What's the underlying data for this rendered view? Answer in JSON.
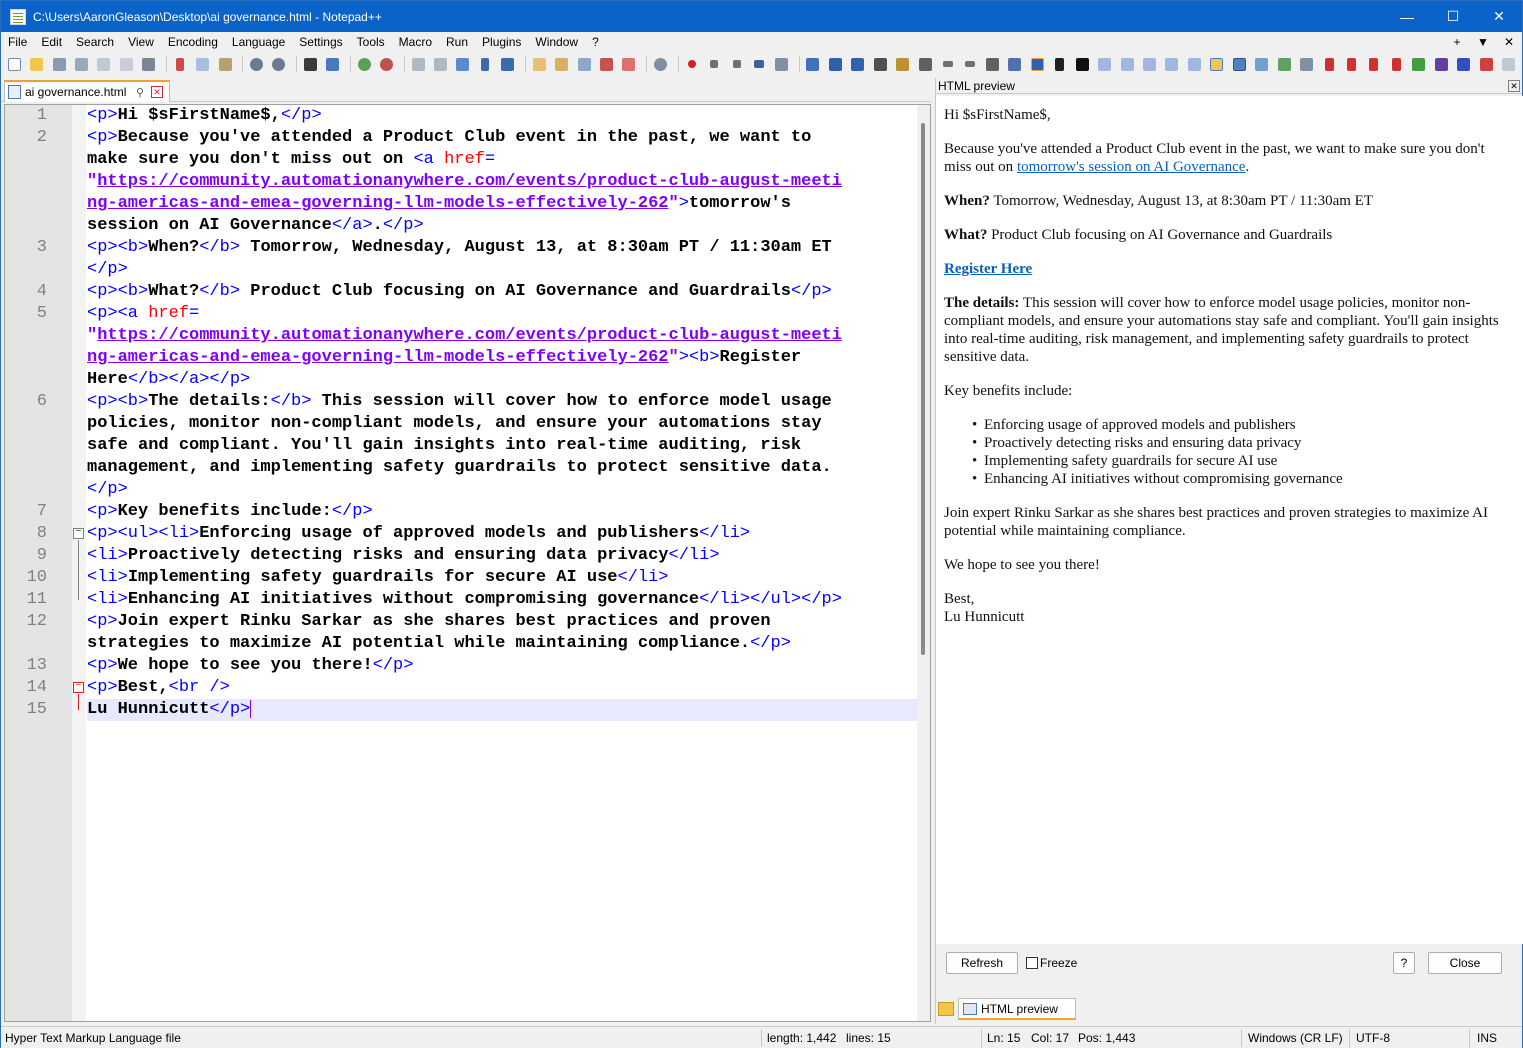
{
  "window": {
    "title": "C:\\Users\\AaronGleason\\Desktop\\ai governance.html - Notepad++",
    "minimize": "—",
    "maximize": "☐",
    "close": "✕"
  },
  "menu": [
    "File",
    "Edit",
    "Search",
    "View",
    "Encoding",
    "Language",
    "Settings",
    "Tools",
    "Macro",
    "Run",
    "Plugins",
    "Window",
    "?"
  ],
  "menu_right": [
    "+",
    "▼",
    "✕"
  ],
  "tab": {
    "label": "ai governance.html",
    "pin": "⚲",
    "close": "✕"
  },
  "editor": {
    "line_numbers": [
      "1",
      "2",
      "3",
      "4",
      "5",
      "6",
      "7",
      "8",
      "9",
      "10",
      "11",
      "12",
      "13",
      "14",
      "15"
    ],
    "l1": {
      "tag_open": "<p>",
      "text": "Hi $sFirstName$,",
      "tag_close": "</p>"
    },
    "l2": {
      "a": "<p>",
      "b": "Because you've attended a Product Club event in the past, we want to",
      "c": "make sure you don't miss out on ",
      "d": "<a ",
      "e": "href",
      "f": "=",
      "g": "\"",
      "h": "https://community.automationanywhere.com/events/product-club-august-meeti",
      "i": "ng-americas-and-emea-governing-llm-models-effectively-262",
      "j": "\"",
      "k": ">",
      "l": "tomorrow's",
      "m": "session on AI Governance",
      "n": "</a>",
      "o": ".",
      "p": "</p>"
    },
    "l3": {
      "a": "<p><b>",
      "b": "When?",
      "c": "</b>",
      "d": " Tomorrow, Wednesday, August 13, at 8:30am PT / 11:30am ET",
      "e": "</p>"
    },
    "l4": {
      "a": "<p><b>",
      "b": "What?",
      "c": "</b>",
      "d": " Product Club focusing on AI Governance and Guardrails",
      "e": "</p>"
    },
    "l5": {
      "a": "<p><a ",
      "b": "href",
      "c": "=",
      "d": "\"",
      "e": "https://community.automationanywhere.com/events/product-club-august-meeti",
      "f": "ng-americas-and-emea-governing-llm-models-effectively-262",
      "g": "\"",
      "h": "><b>",
      "i": "Register",
      "j": "Here",
      "k": "</b></a></p>"
    },
    "l6": {
      "a": "<p><b>",
      "b": "The details:",
      "c": "</b>",
      "d": " This session will cover how to enforce model usage",
      "e": "policies, monitor non-compliant models, and ensure your automations stay",
      "f": "safe and compliant. You'll gain insights into real-time auditing, risk",
      "g": "management, and implementing safety guardrails to protect sensitive data.",
      "h": "</p>"
    },
    "l7": {
      "a": "<p>",
      "b": "Key benefits include:",
      "c": "</p>"
    },
    "l8": {
      "a": "<p><ul><li>",
      "b": "Enforcing usage of approved models and publishers",
      "c": "</li>"
    },
    "l9": {
      "a": "<li>",
      "b": "Proactively detecting risks and ensuring data privacy",
      "c": "</li>"
    },
    "l10": {
      "a": "<li>",
      "b": "Implementing safety guardrails for secure AI use",
      "c": "</li>"
    },
    "l11": {
      "a": "<li>",
      "b": "Enhancing AI initiatives without compromising governance",
      "c": "</li></ul></p>"
    },
    "l12": {
      "a": "<p>",
      "b": "Join expert Rinku Sarkar as she shares best practices and proven",
      "c": "strategies to maximize AI potential while maintaining compliance.",
      "d": "</p>"
    },
    "l13": {
      "a": "<p>",
      "b": "We hope to see you there!",
      "c": "</p>"
    },
    "l14": {
      "a": "<p>",
      "b": "Best,",
      "c": "<br />"
    },
    "l15": {
      "a": "Lu Hunnicutt",
      "b": "</p>"
    }
  },
  "preview": {
    "panel_title": "HTML preview",
    "panel_close": "✕",
    "greeting": "Hi $sFirstName$,",
    "p2_text": "Because you've attended a Product Club event in the past, we want to make sure you don't miss out on ",
    "p2_link": "tomorrow's session on AI Governance",
    "p2_end": ".",
    "when_label": "When?",
    "when_text": " Tomorrow, Wednesday, August 13, at 8:30am PT / 11:30am ET",
    "what_label": "What?",
    "what_text": " Product Club focusing on AI Governance and Guardrails",
    "register": "Register Here",
    "details_label": "The details:",
    "details_text": " This session will cover how to enforce model usage policies, monitor non-compliant models, and ensure your automations stay safe and compliant. You'll gain insights into real-time auditing, risk management, and implementing safety guardrails to protect sensitive data.",
    "benefits_intro": "Key benefits include:",
    "benefits": [
      "Enforcing usage of approved models and publishers",
      "Proactively detecting risks and ensuring data privacy",
      "Implementing safety guardrails for secure AI use",
      "Enhancing AI initiatives without compromising governance"
    ],
    "join": "Join expert Rinku Sarkar as she shares best practices and proven strategies to maximize AI potential while maintaining compliance.",
    "hope": "We hope to see you there!",
    "signoff": "Best,",
    "name": "Lu Hunnicutt",
    "refresh": "Refresh",
    "freeze": "Freeze",
    "help": "?",
    "close": "Close",
    "bottom_tab": "HTML preview"
  },
  "status": {
    "file_type": "Hyper Text Markup Language file",
    "length": "length: 1,442",
    "lines": "lines: 15",
    "ln": "Ln: 15",
    "col": "Col: 17",
    "pos": "Pos: 1,443",
    "eol": "Windows (CR LF)",
    "encoding": "UTF-8",
    "mode": "INS"
  },
  "colors": {
    "titlebar": "#0a63c9",
    "tag": "#0000ff",
    "attr": "#ff0000",
    "value": "#8000ff",
    "link": "#0b5fb8",
    "tab_accent": "#f0a030"
  }
}
